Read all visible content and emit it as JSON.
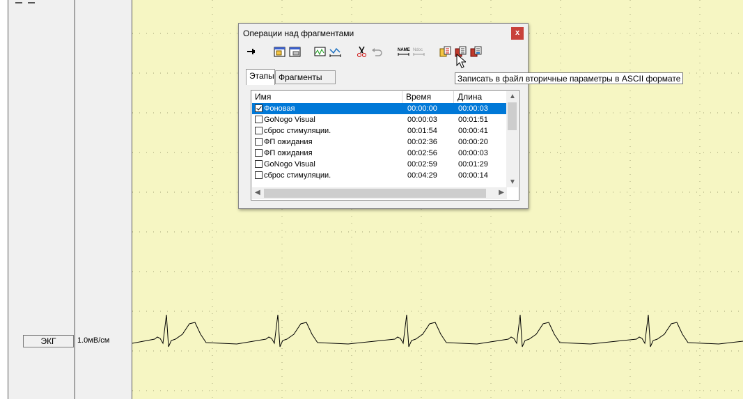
{
  "channel": {
    "name": "ЭКГ",
    "scale": "1.0мВ/см"
  },
  "colors": {
    "plot_background": "#f6f6c3",
    "selection": "#0078d7",
    "close_button": "#c8413a"
  },
  "dialog": {
    "title": "Операции над фрагментами",
    "close_label": "x",
    "toolbar_icons": [
      "pin-icon",
      "add-fragment-icon",
      "fragment-icon",
      "waveform-icon",
      "span-icon",
      "cut-icon",
      "undo-icon",
      "name-span-icon",
      "info-span-icon",
      "copy-icon",
      "export-ascii-icon",
      "export-icon"
    ],
    "tabs": [
      "Этапы",
      "Фрагменты"
    ],
    "active_tab": "Этапы",
    "columns": [
      "Имя",
      "Время",
      "Длина"
    ],
    "rows": [
      {
        "name": "Фоновая",
        "time": "00:00:00",
        "length": "00:00:03",
        "checked": true,
        "selected": true
      },
      {
        "name": "GoNogo Visual",
        "time": "00:00:03",
        "length": "00:01:51",
        "checked": false,
        "selected": false
      },
      {
        "name": "сброс стимуляции.",
        "time": "00:01:54",
        "length": "00:00:41",
        "checked": false,
        "selected": false
      },
      {
        "name": "ФП ожидания",
        "time": "00:02:36",
        "length": "00:00:20",
        "checked": false,
        "selected": false
      },
      {
        "name": "ФП ожидания",
        "time": "00:02:56",
        "length": "00:00:03",
        "checked": false,
        "selected": false
      },
      {
        "name": "GoNogo Visual",
        "time": "00:02:59",
        "length": "00:01:29",
        "checked": false,
        "selected": false
      },
      {
        "name": "сброс стимуляции.",
        "time": "00:04:29",
        "length": "00:00:14",
        "checked": false,
        "selected": false
      }
    ]
  },
  "tooltip": "Записать в файл вторичные параметры в ASCII формате"
}
